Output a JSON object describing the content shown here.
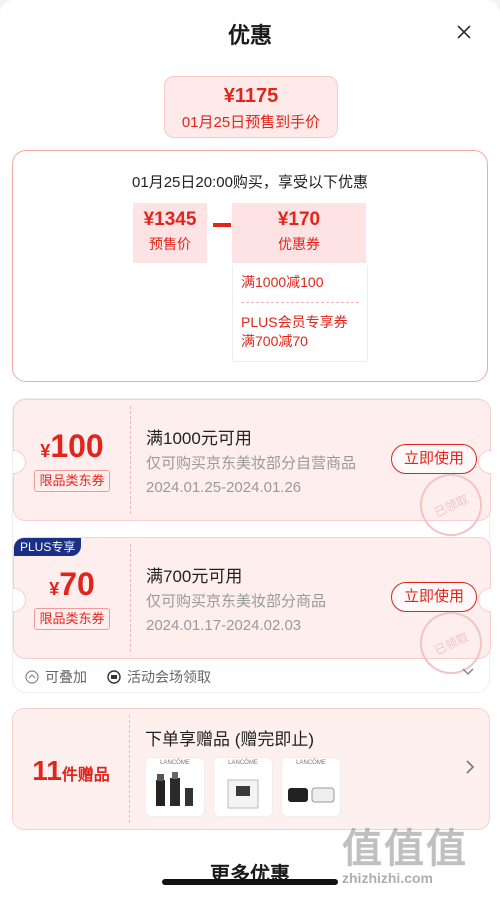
{
  "header": {
    "title": "优惠"
  },
  "summary": {
    "final_price": "¥1175",
    "final_desc": "01月25日预售到手价",
    "calc_title": "01月25日20:00购买，享受以下优惠",
    "presale_amount": "¥1345",
    "presale_label": "预售价",
    "coupon_amount": "¥170",
    "coupon_label": "优惠券",
    "coupon_details": [
      "满1000减100",
      "PLUS会员专享券",
      "满700减70"
    ]
  },
  "coupons": [
    {
      "yen": "¥",
      "value": "100",
      "tag": "限品类东券",
      "condition": "满1000元可用",
      "scope": "仅可购买京东美妆部分自营商品",
      "date": "2024.01.25-2024.01.26",
      "button": "立即使用",
      "stamp": "已领取"
    },
    {
      "badge": "PLUS专享",
      "yen": "¥",
      "value": "70",
      "tag": "限品类东券",
      "condition": "满700元可用",
      "scope": "仅可购买京东美妆部分商品",
      "date": "2024.01.17-2024.02.03",
      "button": "立即使用",
      "stamp": "已领取"
    }
  ],
  "footer": {
    "stackable": "可叠加",
    "source": "活动会场领取"
  },
  "gift": {
    "count": "11",
    "unit": "件赠品",
    "title": "下单享赠品 (赠完即止)",
    "thumbs": [
      "LANCÔME",
      "LANCÔME",
      "LANCÔME"
    ]
  },
  "more_label": "更多优惠",
  "watermark": {
    "text": "值值值",
    "url": "zhizhizhi.com"
  },
  "colors": {
    "accent": "#e1251b",
    "plus_badge": "#1a2f86"
  }
}
